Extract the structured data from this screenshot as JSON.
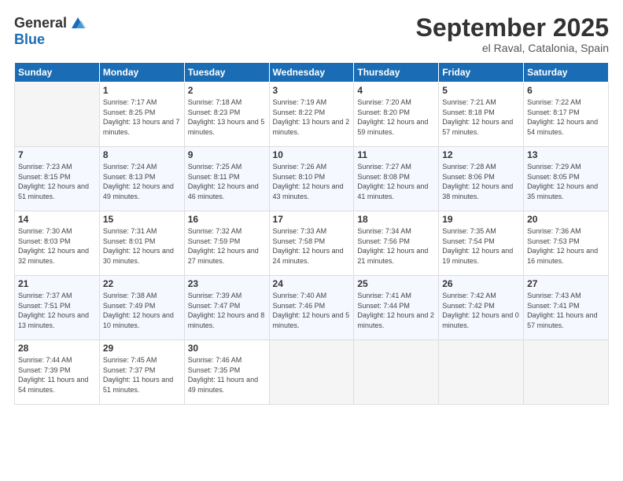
{
  "logo": {
    "general": "General",
    "blue": "Blue"
  },
  "title": "September 2025",
  "subtitle": "el Raval, Catalonia, Spain",
  "weekdays": [
    "Sunday",
    "Monday",
    "Tuesday",
    "Wednesday",
    "Thursday",
    "Friday",
    "Saturday"
  ],
  "days": [
    {
      "date": "",
      "info": ""
    },
    {
      "date": "1",
      "sunrise": "7:17 AM",
      "sunset": "8:25 PM",
      "daylight": "13 hours and 7 minutes."
    },
    {
      "date": "2",
      "sunrise": "7:18 AM",
      "sunset": "8:23 PM",
      "daylight": "13 hours and 5 minutes."
    },
    {
      "date": "3",
      "sunrise": "7:19 AM",
      "sunset": "8:22 PM",
      "daylight": "13 hours and 2 minutes."
    },
    {
      "date": "4",
      "sunrise": "7:20 AM",
      "sunset": "8:20 PM",
      "daylight": "12 hours and 59 minutes."
    },
    {
      "date": "5",
      "sunrise": "7:21 AM",
      "sunset": "8:18 PM",
      "daylight": "12 hours and 57 minutes."
    },
    {
      "date": "6",
      "sunrise": "7:22 AM",
      "sunset": "8:17 PM",
      "daylight": "12 hours and 54 minutes."
    },
    {
      "date": "7",
      "sunrise": "7:23 AM",
      "sunset": "8:15 PM",
      "daylight": "12 hours and 51 minutes."
    },
    {
      "date": "8",
      "sunrise": "7:24 AM",
      "sunset": "8:13 PM",
      "daylight": "12 hours and 49 minutes."
    },
    {
      "date": "9",
      "sunrise": "7:25 AM",
      "sunset": "8:11 PM",
      "daylight": "12 hours and 46 minutes."
    },
    {
      "date": "10",
      "sunrise": "7:26 AM",
      "sunset": "8:10 PM",
      "daylight": "12 hours and 43 minutes."
    },
    {
      "date": "11",
      "sunrise": "7:27 AM",
      "sunset": "8:08 PM",
      "daylight": "12 hours and 41 minutes."
    },
    {
      "date": "12",
      "sunrise": "7:28 AM",
      "sunset": "8:06 PM",
      "daylight": "12 hours and 38 minutes."
    },
    {
      "date": "13",
      "sunrise": "7:29 AM",
      "sunset": "8:05 PM",
      "daylight": "12 hours and 35 minutes."
    },
    {
      "date": "14",
      "sunrise": "7:30 AM",
      "sunset": "8:03 PM",
      "daylight": "12 hours and 32 minutes."
    },
    {
      "date": "15",
      "sunrise": "7:31 AM",
      "sunset": "8:01 PM",
      "daylight": "12 hours and 30 minutes."
    },
    {
      "date": "16",
      "sunrise": "7:32 AM",
      "sunset": "7:59 PM",
      "daylight": "12 hours and 27 minutes."
    },
    {
      "date": "17",
      "sunrise": "7:33 AM",
      "sunset": "7:58 PM",
      "daylight": "12 hours and 24 minutes."
    },
    {
      "date": "18",
      "sunrise": "7:34 AM",
      "sunset": "7:56 PM",
      "daylight": "12 hours and 21 minutes."
    },
    {
      "date": "19",
      "sunrise": "7:35 AM",
      "sunset": "7:54 PM",
      "daylight": "12 hours and 19 minutes."
    },
    {
      "date": "20",
      "sunrise": "7:36 AM",
      "sunset": "7:53 PM",
      "daylight": "12 hours and 16 minutes."
    },
    {
      "date": "21",
      "sunrise": "7:37 AM",
      "sunset": "7:51 PM",
      "daylight": "12 hours and 13 minutes."
    },
    {
      "date": "22",
      "sunrise": "7:38 AM",
      "sunset": "7:49 PM",
      "daylight": "12 hours and 10 minutes."
    },
    {
      "date": "23",
      "sunrise": "7:39 AM",
      "sunset": "7:47 PM",
      "daylight": "12 hours and 8 minutes."
    },
    {
      "date": "24",
      "sunrise": "7:40 AM",
      "sunset": "7:46 PM",
      "daylight": "12 hours and 5 minutes."
    },
    {
      "date": "25",
      "sunrise": "7:41 AM",
      "sunset": "7:44 PM",
      "daylight": "12 hours and 2 minutes."
    },
    {
      "date": "26",
      "sunrise": "7:42 AM",
      "sunset": "7:42 PM",
      "daylight": "12 hours and 0 minutes."
    },
    {
      "date": "27",
      "sunrise": "7:43 AM",
      "sunset": "7:41 PM",
      "daylight": "11 hours and 57 minutes."
    },
    {
      "date": "28",
      "sunrise": "7:44 AM",
      "sunset": "7:39 PM",
      "daylight": "11 hours and 54 minutes."
    },
    {
      "date": "29",
      "sunrise": "7:45 AM",
      "sunset": "7:37 PM",
      "daylight": "11 hours and 51 minutes."
    },
    {
      "date": "30",
      "sunrise": "7:46 AM",
      "sunset": "7:35 PM",
      "daylight": "11 hours and 49 minutes."
    },
    {
      "date": "",
      "info": ""
    },
    {
      "date": "",
      "info": ""
    },
    {
      "date": "",
      "info": ""
    },
    {
      "date": "",
      "info": ""
    }
  ]
}
